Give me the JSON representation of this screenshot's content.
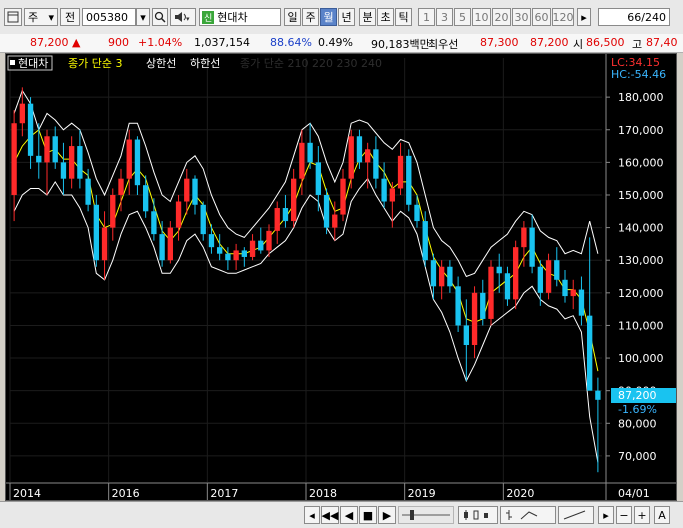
{
  "toolbar": {
    "menu_icon": "window-icon",
    "market": "주",
    "period_type": "전",
    "stock_code": "005380",
    "company": "현대차",
    "new_badge": "신",
    "periods": [
      "일",
      "주",
      "월",
      "년"
    ],
    "active_period": "월",
    "minute_labels": [
      "분",
      "초",
      "틱"
    ],
    "intervals": [
      "1",
      "3",
      "5",
      "10",
      "20",
      "30",
      "60",
      "120"
    ],
    "page_value": "66",
    "page_total": "/240"
  },
  "quote": {
    "price": "87,200",
    "change": "900",
    "change_pct": "+1.04%",
    "volume": "1,037,154",
    "volume_ratio": "88.64%",
    "turnover_pct": "0.49%",
    "trade_value": "90,183백만",
    "best_bid_label": "최우선",
    "best_bid": "87,300",
    "best_ask": "87,200",
    "open_label": "시",
    "open": "86,500",
    "high_label": "고",
    "high": "87,40"
  },
  "legend": {
    "name": "현대차",
    "indicator": "종가 단순 3",
    "upper": "상한선",
    "lower": "하한선",
    "ma_hidden": "종가 단순 210 220 230 240"
  },
  "labels": {
    "lc": "LC:34.15",
    "hc": "HC:-54.46",
    "price_tag": "87,200",
    "pct_tag": "-1.69%",
    "date_tag": "04/01"
  },
  "colors": {
    "up": "#ff2a2a",
    "down": "#19c3f0",
    "ma": "#ffff00",
    "band": "#ffffff",
    "bg": "#000000",
    "label_cyan": "#00cfff"
  },
  "chart_data": {
    "type": "candlestick",
    "y_ticks": [
      70000,
      80000,
      90000,
      100000,
      110000,
      120000,
      130000,
      140000,
      150000,
      160000,
      170000,
      180000
    ],
    "y_range": [
      62000,
      192000
    ],
    "x_ticks": [
      "2014",
      "2016",
      "2017",
      "2018",
      "2019",
      "2020"
    ],
    "candles": [
      [
        150000,
        176000,
        142000,
        172000
      ],
      [
        172000,
        183000,
        168000,
        178000
      ],
      [
        178000,
        180000,
        158000,
        162000
      ],
      [
        162000,
        172000,
        155000,
        160000
      ],
      [
        160000,
        170000,
        150000,
        168000
      ],
      [
        168000,
        171000,
        158000,
        160000
      ],
      [
        160000,
        166000,
        150000,
        155000
      ],
      [
        155000,
        168000,
        152000,
        165000
      ],
      [
        165000,
        170000,
        152000,
        155000
      ],
      [
        155000,
        158000,
        145000,
        147000
      ],
      [
        147000,
        150000,
        128000,
        130000
      ],
      [
        130000,
        145000,
        124000,
        140000
      ],
      [
        140000,
        152000,
        136000,
        150000
      ],
      [
        150000,
        158000,
        145000,
        155000
      ],
      [
        155000,
        170000,
        150000,
        167000
      ],
      [
        167000,
        168000,
        150000,
        153000
      ],
      [
        153000,
        156000,
        143000,
        145000
      ],
      [
        145000,
        149000,
        136000,
        138000
      ],
      [
        138000,
        142000,
        128000,
        130000
      ],
      [
        130000,
        142000,
        129000,
        140000
      ],
      [
        140000,
        150000,
        136000,
        148000
      ],
      [
        148000,
        158000,
        144000,
        155000
      ],
      [
        155000,
        156000,
        144000,
        147000
      ],
      [
        147000,
        148000,
        136000,
        138000
      ],
      [
        138000,
        141000,
        132000,
        134000
      ],
      [
        134000,
        138000,
        130000,
        132000
      ],
      [
        132000,
        134000,
        127000,
        130000
      ],
      [
        130000,
        135000,
        127000,
        133000
      ],
      [
        133000,
        134000,
        128000,
        131000
      ],
      [
        131000,
        138000,
        130000,
        136000
      ],
      [
        136000,
        140000,
        132000,
        133000
      ],
      [
        133000,
        141000,
        131000,
        139000
      ],
      [
        139000,
        148000,
        135000,
        146000
      ],
      [
        146000,
        150000,
        140000,
        142000
      ],
      [
        142000,
        158000,
        140000,
        155000
      ],
      [
        155000,
        170000,
        150000,
        166000
      ],
      [
        166000,
        172000,
        158000,
        160000
      ],
      [
        160000,
        165000,
        145000,
        150000
      ],
      [
        150000,
        152000,
        138000,
        140000
      ],
      [
        140000,
        148000,
        136000,
        144000
      ],
      [
        144000,
        158000,
        142000,
        155000
      ],
      [
        155000,
        170000,
        152000,
        168000
      ],
      [
        168000,
        170000,
        158000,
        160000
      ],
      [
        160000,
        166000,
        152000,
        164000
      ],
      [
        164000,
        168000,
        152000,
        155000
      ],
      [
        155000,
        160000,
        146000,
        148000
      ],
      [
        148000,
        154000,
        140000,
        152000
      ],
      [
        152000,
        166000,
        150000,
        162000
      ],
      [
        162000,
        164000,
        145000,
        147000
      ],
      [
        147000,
        150000,
        140000,
        142000
      ],
      [
        142000,
        145000,
        128000,
        130000
      ],
      [
        130000,
        132000,
        118000,
        122000
      ],
      [
        122000,
        130000,
        118000,
        128000
      ],
      [
        128000,
        130000,
        120000,
        122000
      ],
      [
        122000,
        125000,
        108000,
        110000
      ],
      [
        110000,
        118000,
        93000,
        104000
      ],
      [
        104000,
        122000,
        100000,
        120000
      ],
      [
        120000,
        124000,
        110000,
        112000
      ],
      [
        112000,
        130000,
        110000,
        128000
      ],
      [
        128000,
        132000,
        120000,
        126000
      ],
      [
        126000,
        128000,
        116000,
        118000
      ],
      [
        118000,
        136000,
        115000,
        134000
      ],
      [
        134000,
        142000,
        128000,
        140000
      ],
      [
        140000,
        144000,
        126000,
        128000
      ],
      [
        128000,
        130000,
        116000,
        120000
      ],
      [
        120000,
        132000,
        118000,
        130000
      ],
      [
        130000,
        134000,
        122000,
        124000
      ],
      [
        124000,
        127000,
        117000,
        119000
      ],
      [
        119000,
        124000,
        115000,
        121000
      ],
      [
        121000,
        125000,
        110000,
        113000
      ],
      [
        113000,
        137000,
        105000,
        90000
      ],
      [
        90000,
        94000,
        65000,
        87200
      ]
    ],
    "ma3": [
      160000,
      165000,
      168000,
      170000,
      163000,
      164000,
      161000,
      161000,
      158000,
      156000,
      144000,
      140000,
      141000,
      148000,
      155000,
      158000,
      155000,
      147000,
      139000,
      136000,
      139000,
      145000,
      150000,
      147000,
      140000,
      135000,
      132000,
      132000,
      132000,
      133000,
      134000,
      137000,
      140000,
      143000,
      147000,
      154000,
      160000,
      159000,
      151000,
      145000,
      146000,
      155000,
      161000,
      164000,
      160000,
      157000,
      152000,
      154000,
      154000,
      150000,
      140000,
      131000,
      127000,
      124000,
      120000,
      112000,
      111000,
      112000,
      120000,
      122000,
      124000,
      126000,
      131000,
      134000,
      129000,
      126000,
      125000,
      121000,
      121000,
      118000,
      108000,
      96000
    ],
    "upper": [
      175000,
      182000,
      178000,
      170000,
      175000,
      173000,
      170000,
      172000,
      170000,
      163000,
      155000,
      150000,
      156000,
      162000,
      172000,
      172000,
      165000,
      157000,
      150000,
      148000,
      154000,
      160000,
      162000,
      158000,
      150000,
      144000,
      140000,
      138000,
      137000,
      140000,
      143000,
      146000,
      150000,
      154000,
      162000,
      170000,
      172000,
      168000,
      160000,
      154000,
      160000,
      172000,
      173000,
      172000,
      169000,
      166000,
      164000,
      167000,
      166000,
      160000,
      150000,
      140000,
      136000,
      134000,
      130000,
      125000,
      126000,
      130000,
      134000,
      136000,
      138000,
      142000,
      145000,
      144000,
      139000,
      137000,
      136000,
      132000,
      133000,
      132000,
      142000,
      132000
    ],
    "lower": [
      145000,
      150000,
      152000,
      152000,
      150000,
      154000,
      150000,
      150000,
      146000,
      140000,
      126000,
      124000,
      130000,
      138000,
      144000,
      145000,
      140000,
      134000,
      126000,
      126000,
      130000,
      136000,
      138000,
      134000,
      128000,
      127000,
      126000,
      126000,
      127000,
      128000,
      129000,
      132000,
      134000,
      136000,
      140000,
      146000,
      150000,
      148000,
      140000,
      136000,
      138000,
      148000,
      152000,
      155000,
      150000,
      146000,
      142000,
      145000,
      143000,
      138000,
      128000,
      118000,
      114000,
      108000,
      100000,
      93000,
      98000,
      104000,
      110000,
      112000,
      114000,
      116000,
      120000,
      122000,
      118000,
      116000,
      115000,
      112000,
      113000,
      108000,
      82000,
      68000
    ]
  },
  "bottombar": {
    "nav": [
      "◀◀",
      "◀",
      "■",
      "▶"
    ],
    "zoom_out": "−",
    "zoom_in": "+",
    "font_label": "A",
    "scroll_icons": [
      "left-arrow-icon",
      "right-arrow-icon"
    ]
  }
}
